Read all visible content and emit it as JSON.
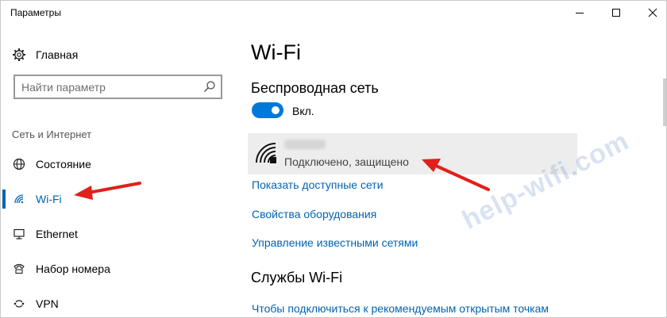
{
  "window": {
    "title": "Параметры"
  },
  "sidebar": {
    "home_label": "Главная",
    "search_placeholder": "Найти параметр",
    "section_label": "Сеть и Интернет",
    "items": [
      {
        "label": "Состояние",
        "icon": "globe-icon",
        "active": false
      },
      {
        "label": "Wi-Fi",
        "icon": "wifi-icon",
        "active": true
      },
      {
        "label": "Ethernet",
        "icon": "ethernet-monitor-icon",
        "active": false
      },
      {
        "label": "Набор номера",
        "icon": "dialup-phone-icon",
        "active": false
      },
      {
        "label": "VPN",
        "icon": "vpn-icon",
        "active": false
      }
    ]
  },
  "content": {
    "page_title": "Wi-Fi",
    "wireless_heading": "Беспроводная сеть",
    "toggle_label": "Вкл.",
    "toggle_state": "on",
    "network": {
      "status": "Подключено, защищено"
    },
    "links": [
      "Показать доступные сети",
      "Свойства оборудования",
      "Управление известными сетями"
    ],
    "services_heading": "Службы Wi-Fi",
    "services_link": "Чтобы подключиться к рекомендуемым открытым точкам"
  },
  "watermark": "help-wifi.com",
  "colors": {
    "accent": "#0063b1",
    "toggle_on": "#0078d7",
    "annotation_arrow": "#e0201b"
  }
}
